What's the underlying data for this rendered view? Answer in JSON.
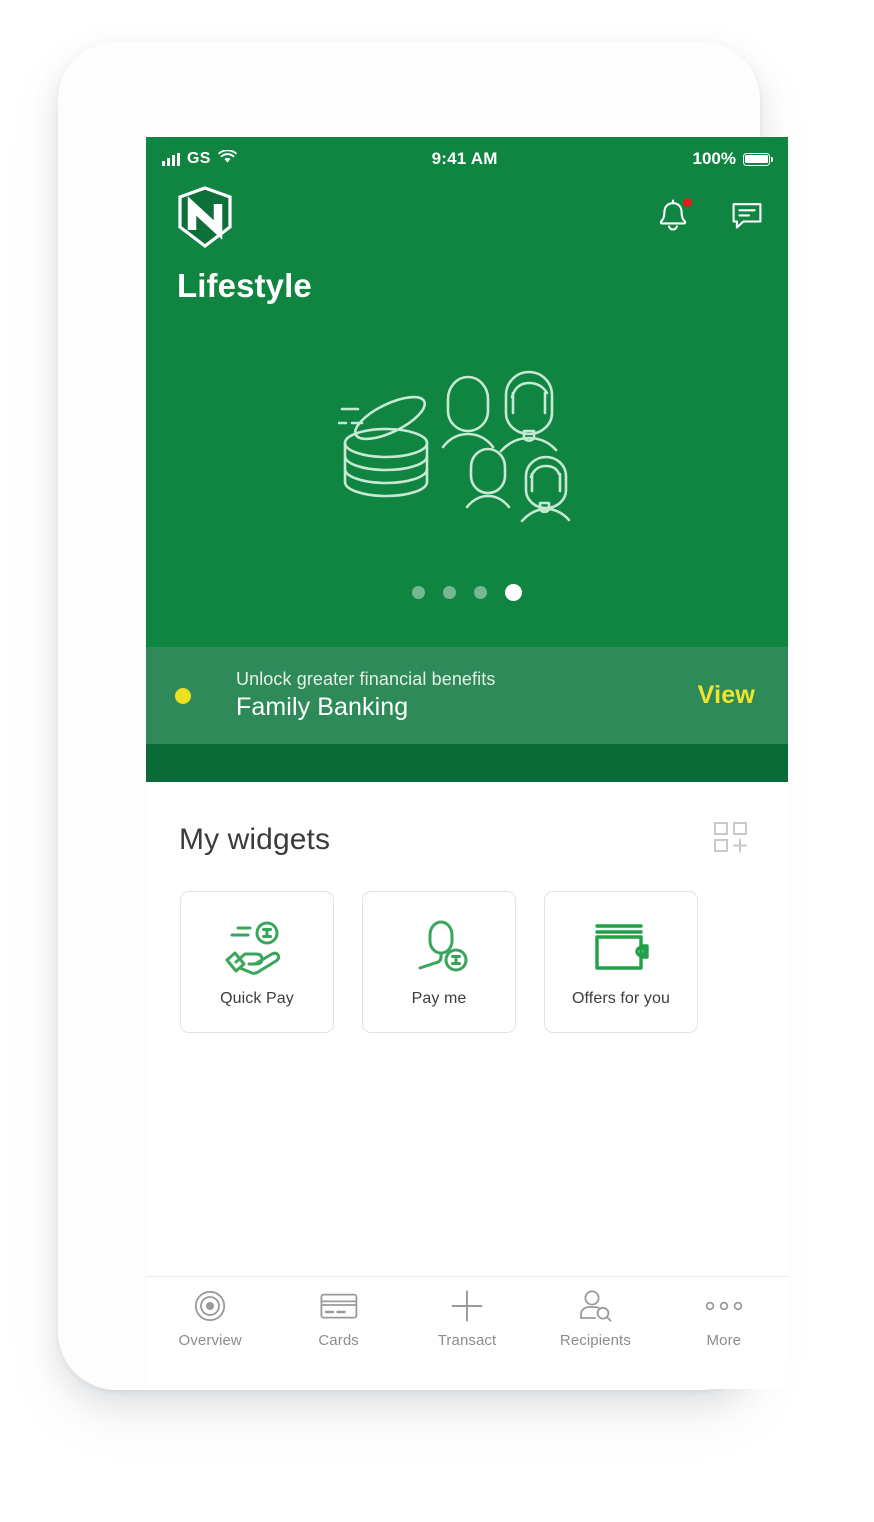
{
  "status_bar": {
    "signal_icon": "signal-bars-icon",
    "carrier": "GS",
    "wifi_icon": "wifi-icon",
    "time": "9:41 AM",
    "battery_percent": "100%",
    "battery_icon": "battery-full-icon"
  },
  "app_bar": {
    "logo_name": "nedbank-logo",
    "notifications_icon": "bell-icon",
    "notifications_has_badge": true,
    "messages_icon": "chat-bubble-icon"
  },
  "hero": {
    "title": "Lifestyle",
    "illustration": "family-savings-illustration",
    "carousel": {
      "total": 4,
      "active_index": 3
    }
  },
  "promo": {
    "status_dot_color": "#e9e11f",
    "kicker": "Unlock greater financial benefits",
    "title": "Family Banking",
    "cta_label": "View",
    "cta_color": "#f0e52a"
  },
  "widgets": {
    "title": "My widgets",
    "add_icon": "add-widget-grid-icon",
    "items": [
      {
        "label": "Quick Pay",
        "icon": "hand-coin-icon"
      },
      {
        "label": "Pay me",
        "icon": "person-coin-icon"
      },
      {
        "label": "Offers for you",
        "icon": "wallet-icon"
      }
    ]
  },
  "bottom_nav": {
    "items": [
      {
        "label": "Overview",
        "icon": "target-icon"
      },
      {
        "label": "Cards",
        "icon": "credit-card-icon"
      },
      {
        "label": "Transact",
        "icon": "plus-icon"
      },
      {
        "label": "Recipients",
        "icon": "person-search-icon"
      },
      {
        "label": "More",
        "icon": "ellipsis-icon"
      }
    ]
  },
  "theme": {
    "brand_green": "#108441",
    "promo_green": "#2f8a59",
    "strip_green": "#0b6b38",
    "accent_yellow": "#f0e52a",
    "badge_red": "#e01b1b"
  }
}
